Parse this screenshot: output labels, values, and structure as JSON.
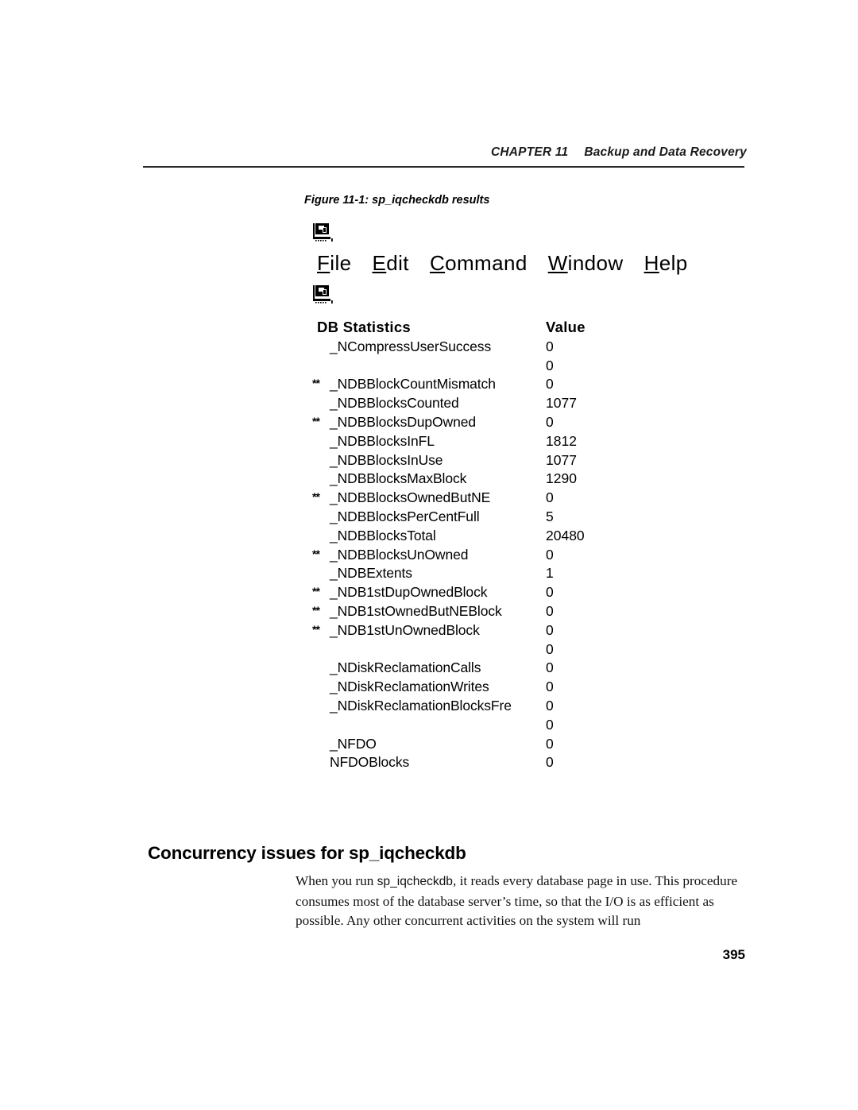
{
  "header": {
    "chapter": "CHAPTER 11",
    "title": "Backup and Data Recovery"
  },
  "figure": {
    "caption": "Figure 11-1: sp_iqcheckdb results",
    "window_icon": "computer-icon",
    "menu": [
      {
        "mnemonic": "F",
        "rest": "ile"
      },
      {
        "mnemonic": "E",
        "rest": "dit"
      },
      {
        "mnemonic": "C",
        "rest": "ommand"
      },
      {
        "mnemonic": "W",
        "rest": "indow"
      },
      {
        "mnemonic": "H",
        "rest": "elp"
      }
    ],
    "columns": {
      "name": "DB Statistics",
      "value": "Value"
    },
    "rows": [
      {
        "flag": "",
        "name": "_NCompressUserSuccess",
        "value": "0"
      },
      {
        "flag": "",
        "name": "",
        "value": "0"
      },
      {
        "flag": "**",
        "name": "_NDBBlockCountMismatch",
        "value": "0"
      },
      {
        "flag": "",
        "name": "_NDBBlocksCounted",
        "value": "1077"
      },
      {
        "flag": "**",
        "name": "_NDBBlocksDupOwned",
        "value": "0"
      },
      {
        "flag": "",
        "name": "_NDBBlocksInFL",
        "value": "1812"
      },
      {
        "flag": "",
        "name": "_NDBBlocksInUse",
        "value": "1077"
      },
      {
        "flag": "",
        "name": "_NDBBlocksMaxBlock",
        "value": "1290"
      },
      {
        "flag": "**",
        "name": "_NDBBlocksOwnedButNE",
        "value": "0"
      },
      {
        "flag": "",
        "name": "_NDBBlocksPerCentFull",
        "value": "5"
      },
      {
        "flag": "",
        "name": "_NDBBlocksTotal",
        "value": "20480"
      },
      {
        "flag": "**",
        "name": "_NDBBlocksUnOwned",
        "value": "0"
      },
      {
        "flag": "",
        "name": "_NDBExtents",
        "value": "1"
      },
      {
        "flag": "**",
        "name": "_NDB1stDupOwnedBlock",
        "value": "0"
      },
      {
        "flag": "**",
        "name": "_NDB1stOwnedButNEBlock",
        "value": "0"
      },
      {
        "flag": "**",
        "name": "_NDB1stUnOwnedBlock",
        "value": "0"
      },
      {
        "flag": "",
        "name": "",
        "value": "0"
      },
      {
        "flag": "",
        "name": "_NDiskReclamationCalls",
        "value": "0"
      },
      {
        "flag": "",
        "name": "_NDiskReclamationWrites",
        "value": "0"
      },
      {
        "flag": "",
        "name": "_NDiskReclamationBlocksFre",
        "value": "0"
      },
      {
        "flag": "",
        "name": "",
        "value": "0"
      },
      {
        "flag": "",
        "name": "_NFDO",
        "value": "0"
      },
      {
        "flag": "",
        "name": "NFDOBlocks",
        "value": "0"
      }
    ]
  },
  "section": {
    "heading": "Concurrency issues for sp_iqcheckdb",
    "paragraph_pre": "When you run ",
    "paragraph_mono": "sp_iqcheckdb",
    "paragraph_post": ", it reads every database page in use. This procedure consumes most of the database server’s time, so that the I/O is as efficient as possible. Any other concurrent activities on the system will run"
  },
  "folio": "395"
}
